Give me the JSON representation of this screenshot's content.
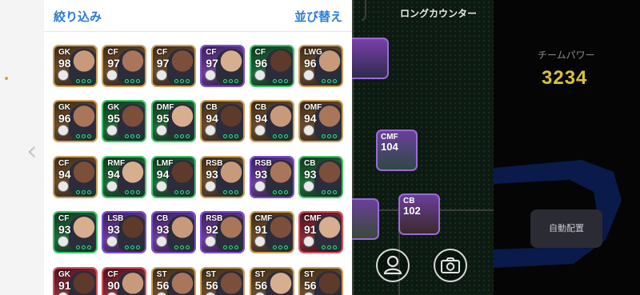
{
  "header": {
    "filter_label": "絞り込み",
    "sort_label": "並び替え"
  },
  "pitch": {
    "title": "ロングカウンター",
    "cards": [
      {
        "position": "",
        "ovr": "",
        "frame": "purple"
      },
      {
        "position": "CMF",
        "ovr": "104",
        "frame": "purple"
      },
      {
        "position": "CB",
        "ovr": "102",
        "frame": "purple"
      },
      {
        "position": "",
        "ovr": "",
        "frame": "purple"
      }
    ]
  },
  "team_power": {
    "label": "チームパワー",
    "value": "3234"
  },
  "actions": {
    "auto_lineup": "自動配置"
  },
  "colors": {
    "accent_blue": "#2a7bd6",
    "power_gold": "#d8c23c",
    "frame_gold": "#c9a25a",
    "frame_purple": "#7a4fcf",
    "frame_green": "#3fc46a",
    "frame_red": "#d9505a"
  },
  "players": [
    {
      "position": "GK",
      "ovr": "98",
      "frame": "gold"
    },
    {
      "position": "CF",
      "ovr": "97",
      "frame": "gold"
    },
    {
      "position": "CF",
      "ovr": "97",
      "frame": "gold"
    },
    {
      "position": "CF",
      "ovr": "97",
      "frame": "purple"
    },
    {
      "position": "CF",
      "ovr": "96",
      "frame": "green"
    },
    {
      "position": "LWG",
      "ovr": "96",
      "frame": "gold"
    },
    {
      "position": "GK",
      "ovr": "96",
      "frame": "gold"
    },
    {
      "position": "GK",
      "ovr": "95",
      "frame": "green"
    },
    {
      "position": "DMF",
      "ovr": "95",
      "frame": "green"
    },
    {
      "position": "CB",
      "ovr": "94",
      "frame": "gold"
    },
    {
      "position": "CB",
      "ovr": "94",
      "frame": "gold"
    },
    {
      "position": "OMF",
      "ovr": "94",
      "frame": "gold"
    },
    {
      "position": "CF",
      "ovr": "94",
      "frame": "gold"
    },
    {
      "position": "RMF",
      "ovr": "94",
      "frame": "green"
    },
    {
      "position": "LMF",
      "ovr": "94",
      "frame": "green"
    },
    {
      "position": "RSB",
      "ovr": "93",
      "frame": "gold"
    },
    {
      "position": "RSB",
      "ovr": "93",
      "frame": "purple"
    },
    {
      "position": "CB",
      "ovr": "93",
      "frame": "green"
    },
    {
      "position": "CF",
      "ovr": "93",
      "frame": "green"
    },
    {
      "position": "LSB",
      "ovr": "93",
      "frame": "purple"
    },
    {
      "position": "CB",
      "ovr": "93",
      "frame": "purple"
    },
    {
      "position": "RSB",
      "ovr": "92",
      "frame": "purple"
    },
    {
      "position": "CMF",
      "ovr": "91",
      "frame": "gold"
    },
    {
      "position": "CMF",
      "ovr": "91",
      "frame": "red"
    },
    {
      "position": "GK",
      "ovr": "91",
      "frame": "red"
    },
    {
      "position": "CF",
      "ovr": "90",
      "frame": "red"
    },
    {
      "position": "ST",
      "ovr": "56",
      "frame": "gold"
    },
    {
      "position": "ST",
      "ovr": "56",
      "frame": "gold"
    },
    {
      "position": "ST",
      "ovr": "56",
      "frame": "gold"
    },
    {
      "position": "ST",
      "ovr": "56",
      "frame": "gold"
    }
  ]
}
